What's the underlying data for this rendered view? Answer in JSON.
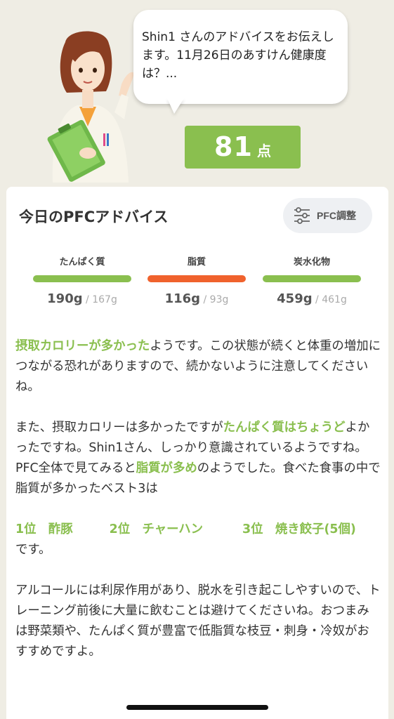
{
  "hero": {
    "bubble_text": "Shin1 さんのアドバイスをお伝えします。11月26日のあすけん健康度は？...",
    "score_value": "81",
    "score_unit": "点"
  },
  "card": {
    "title": "今日のPFCアドバイス",
    "pfc_button_label": "PFC調整",
    "macros": [
      {
        "label": "たんぱく質",
        "actual": "190g",
        "target": " / 167g",
        "color": "#8abf4f"
      },
      {
        "label": "脂質",
        "actual": "116g",
        "target": " / 93g",
        "color": "#f0622d"
      },
      {
        "label": "炭水化物",
        "actual": "459g",
        "target": " / 461g",
        "color": "#8abf4f"
      }
    ],
    "advice": {
      "p1_hl": "摂取カロリーが多かった",
      "p1_rest": "ようです。この状態が続くと体重の増加につながる恐れがありますので、続かないように注意してくださいね。",
      "p2_pre": "また、摂取カロリーは多かったですが",
      "p2_hl": "たんぱく質はちょうど",
      "p2_rest": "よかったですね。Shin1さん、しっかり意識されているようですね。",
      "p3_pre": "PFC全体で見てみると",
      "p3_hl": "脂質が多め",
      "p3_rest": "のようでした。食べた食事の中で脂質が多かったベスト3は",
      "rank1": "1位　酢豚",
      "rank2": "2位　チャーハン",
      "rank3": "3位　焼き餃子(5個)",
      "p4": "です。",
      "p5": "アルコールには利尿作用があり、脱水を引き起こしやすいので、トレーニング前後に大量に飲むことは避けてくださいね。おつまみは野菜類や、たんぱく質が豊富で低脂質な枝豆・刺身・冷奴がおすすめですよ。"
    }
  },
  "colors": {
    "accent_green": "#8abf4f",
    "fat_orange": "#f0622d",
    "background": "#efede4"
  }
}
